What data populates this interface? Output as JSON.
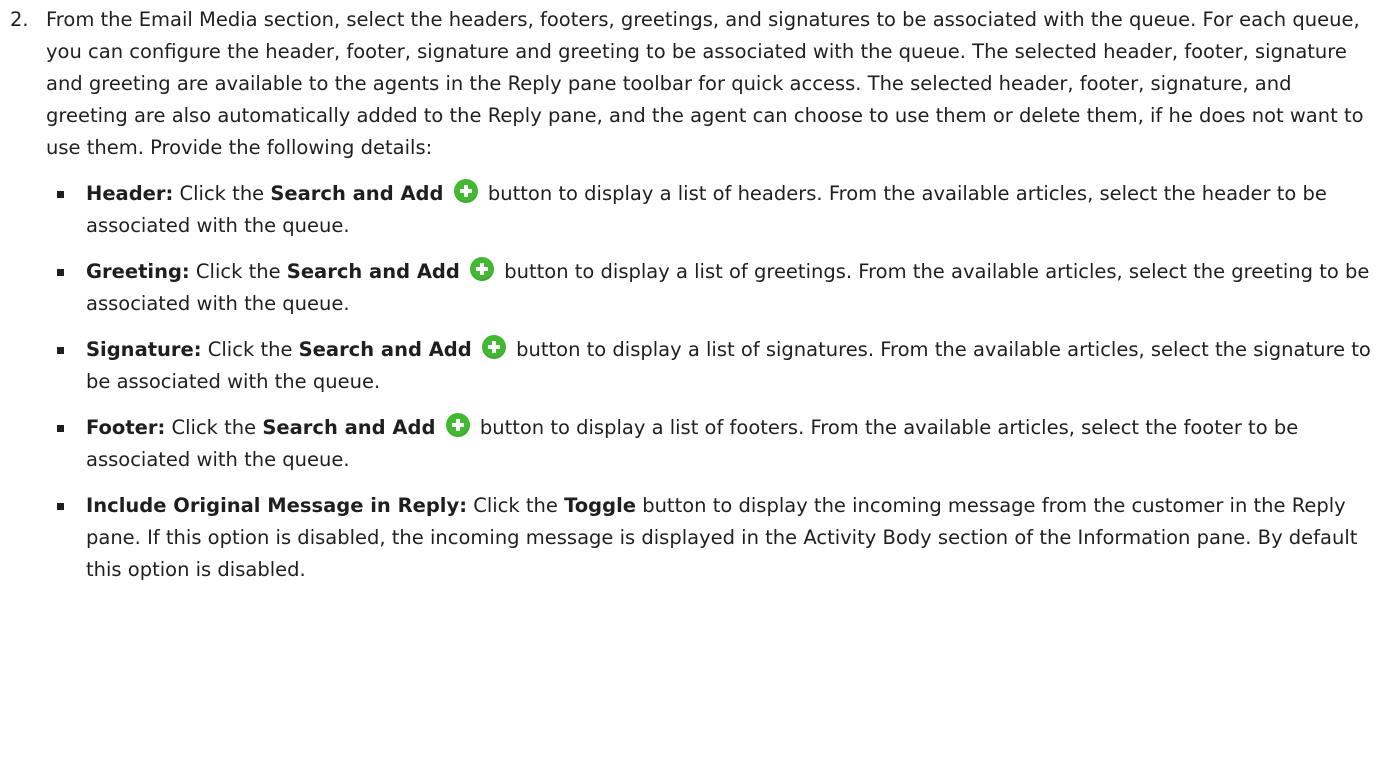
{
  "step": {
    "number": "2.",
    "intro": "From the Email Media section, select the headers, footers, greetings, and signatures to be associated with the queue. For each queue, you can configure the header, footer, signature and greeting to be associated with the queue. The selected header, footer, signature and greeting are available to the agents in the Reply pane toolbar for quick access. The selected header, footer, signature, and greeting are also automatically added to the Reply pane, and the agent can choose to use them or delete them, if he does not want to use them. Provide the following details:"
  },
  "bullets": [
    {
      "term": "Header:",
      "pre": " Click the ",
      "button_label": "Search and Add",
      "icon": "plus-circle-icon",
      "post": " button to display a list of headers. From the available articles, select the header to be associated with the queue."
    },
    {
      "term": "Greeting:",
      "pre": " Click the ",
      "button_label": "Search and Add",
      "icon": "plus-circle-icon",
      "post": " button to display a list of greetings. From the available articles, select the greeting to be associated with the queue."
    },
    {
      "term": "Signature:",
      "pre": " Click the ",
      "button_label": "Search and Add",
      "icon": "plus-circle-icon",
      "post": " button to display a list of signatures. From the available articles, select the signature to be associated with the queue."
    },
    {
      "term": "Footer:",
      "pre": " Click the ",
      "button_label": "Search and Add",
      "icon": "plus-circle-icon",
      "post": " button to display a list of footers. From the available articles, select the footer to be associated with the queue."
    },
    {
      "term": "Include Original Message in Reply:",
      "pre": " Click the ",
      "button_label": "Toggle",
      "post": " button to display the incoming message from the customer in the Reply pane. If this option is disabled, the incoming message is displayed in the Activity Body section of the Information pane. By default this option is disabled."
    }
  ],
  "colors": {
    "text": "#1f1f1f",
    "add_icon": "#43b833"
  }
}
